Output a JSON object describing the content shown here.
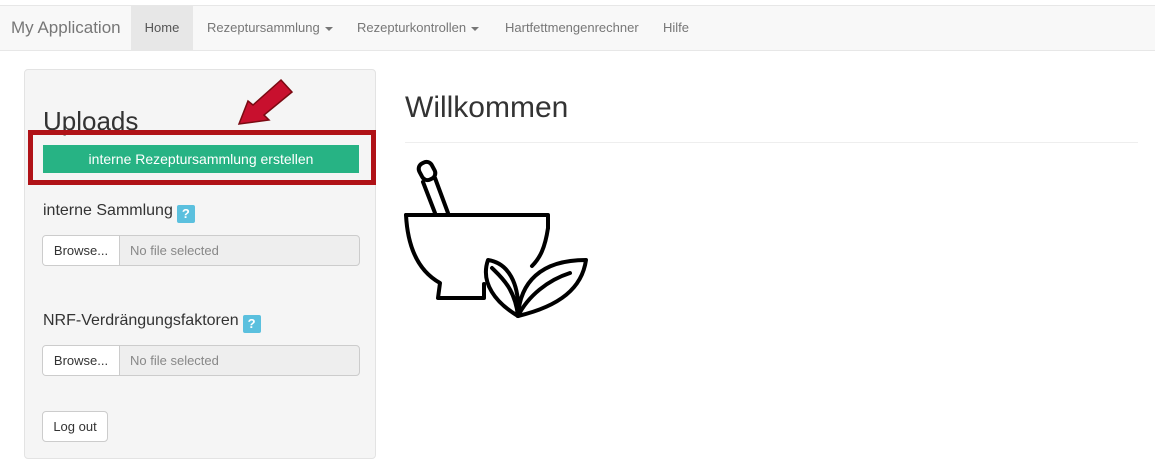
{
  "nav": {
    "brand": "My Application",
    "items": [
      {
        "label": "Home",
        "active": true
      },
      {
        "label": "Rezeptursammlung",
        "dropdown": true
      },
      {
        "label": "Rezepturkontrollen",
        "dropdown": true
      },
      {
        "label": "Hartfettmengenrechner"
      },
      {
        "label": "Hilfe"
      }
    ]
  },
  "sidebar": {
    "title": "Uploads",
    "create_button": "interne Rezeptursammlung erstellen",
    "highlight_color": "#b01217",
    "accent_color": "#27b384",
    "sections": [
      {
        "label": "interne Sammlung",
        "help": "?",
        "browse": "Browse...",
        "file": "No file selected"
      },
      {
        "label": "NRF-Verdrängungsfaktoren",
        "help": "?",
        "browse": "Browse...",
        "file": "No file selected"
      }
    ],
    "logout": "Log out"
  },
  "main": {
    "title": "Willkommen",
    "illustration": "mortar-pestle-leaves-icon"
  }
}
